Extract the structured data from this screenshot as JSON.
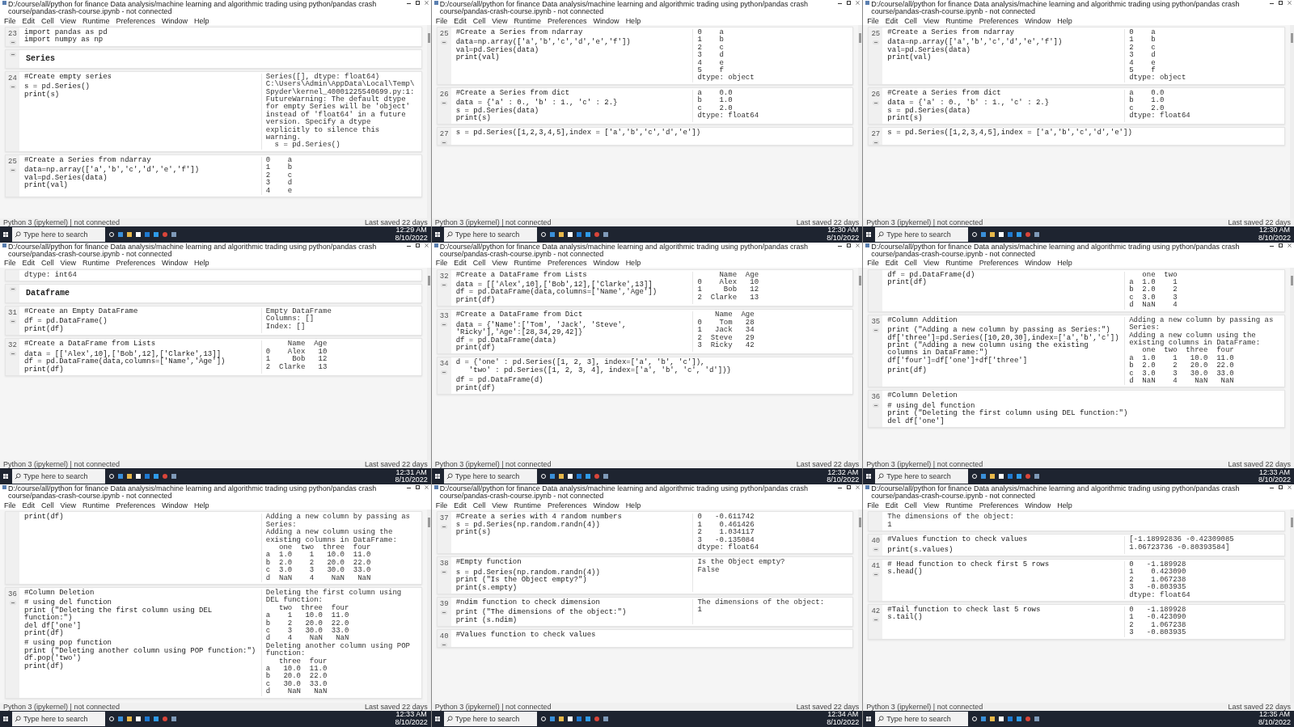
{
  "panels": [
    {
      "title": "D:/course/all/python for finance Data analysis/machine learning and algorithmic trading using python/pandas crash course/pandas-crash-course.ipynb - not connected",
      "menu": [
        "File",
        "Edit",
        "Cell",
        "View",
        "Runtime",
        "Preferences",
        "Window",
        "Help"
      ],
      "cells": [
        {
          "kind": "code",
          "number": "23",
          "code": [
            [
              "import pandas as pd",
              "import numpy as np"
            ]
          ]
        },
        {
          "kind": "markdown",
          "heading": "Series"
        },
        {
          "kind": "code",
          "number": "24",
          "code": [
            [
              "#Create empty series"
            ],
            [
              "s = pd.Series()",
              "print(s)"
            ]
          ],
          "output": [
            "Series([], dtype: float64)",
            "C:\\Users\\Admin\\AppData\\Local\\Temp\\Spyder\\kernel_40001225540699.py:1: FutureWarning: The default dtype for empty Series will be 'object' instead of 'float64' in a future",
            "version. Specify a dtype explicitly to silence this warning.",
            "  s = pd.Series()"
          ]
        },
        {
          "kind": "code",
          "number": "25",
          "code": [
            [
              "#Create a Series from ndarray"
            ],
            [
              "data=np.array(['a','b','c','d','e','f'])",
              "val=pd.Series(data)",
              "print(val)"
            ]
          ],
          "output": [
            "0    a",
            "1    b",
            "2    c",
            "3    d",
            "4    e"
          ]
        }
      ],
      "status": {
        "left": "Python 3 (ipykernel) | not connected",
        "right": "Last saved 22 days"
      },
      "taskbar": {
        "search_placeholder": "Type here to search",
        "time": "12:29 AM",
        "date": "8/10/2022"
      }
    },
    {
      "title": "D:/course/all/python for finance Data analysis/machine learning and algorithmic trading using python/pandas crash course/pandas-crash-course.ipynb - not connected",
      "menu": [
        "File",
        "Edit",
        "Cell",
        "View",
        "Runtime",
        "Preferences",
        "Window",
        "Help"
      ],
      "cells": [
        {
          "kind": "code",
          "number": "25",
          "code": [
            [
              "#Create a Series from ndarray"
            ],
            [
              "data=np.array(['a','b','c','d','e','f'])",
              "val=pd.Series(data)",
              "print(val)"
            ]
          ],
          "output": [
            "0    a",
            "1    b",
            "2    c",
            "3    d",
            "4    e",
            "5    f",
            "dtype: object"
          ]
        },
        {
          "kind": "code",
          "number": "26",
          "code": [
            [
              "#Create a Series from dict"
            ],
            [
              "data = {'a' : 0., 'b' : 1., 'c' : 2.}",
              "s = pd.Series(data)",
              "print(s)"
            ]
          ],
          "output": [
            "a    0.0",
            "b    1.0",
            "c    2.0",
            "dtype: float64"
          ]
        },
        {
          "kind": "code",
          "number": "27",
          "code": [
            [
              "s = pd.Series([1,2,3,4,5],index = ['a','b','c','d','e'])"
            ]
          ]
        }
      ],
      "status": {
        "left": "Python 3 (ipykernel) | not connected",
        "right": "Last saved 22 days"
      },
      "taskbar": {
        "search_placeholder": "Type here to search",
        "time": "12:30 AM",
        "date": "8/10/2022"
      }
    },
    {
      "title": "D:/course/all/python for finance Data analysis/machine learning and algorithmic trading using python/pandas crash course/pandas-crash-course.ipynb - not connected",
      "menu": [
        "File",
        "Edit",
        "Cell",
        "View",
        "Runtime",
        "Preferences",
        "Window",
        "Help"
      ],
      "cells": [
        {
          "kind": "code",
          "number": "25",
          "code": [
            [
              "#Create a Series from ndarray"
            ],
            [
              "data=np.array(['a','b','c','d','e','f'])",
              "val=pd.Series(data)",
              "print(val)"
            ]
          ],
          "output": [
            "0    a",
            "1    b",
            "2    c",
            "3    d",
            "4    e",
            "5    f",
            "dtype: object"
          ]
        },
        {
          "kind": "code",
          "number": "26",
          "code": [
            [
              "#Create a Series from dict"
            ],
            [
              "data = {'a' : 0., 'b' : 1., 'c' : 2.}",
              "s = pd.Series(data)",
              "print(s)"
            ]
          ],
          "output": [
            "a    0.0",
            "b    1.0",
            "c    2.0",
            "dtype: float64"
          ]
        },
        {
          "kind": "code",
          "number": "27",
          "code": [
            [
              "s = pd.Series([1,2,3,4,5],index = ['a','b','c','d','e'])"
            ]
          ]
        }
      ],
      "status": {
        "left": "Python 3 (ipykernel) | not connected",
        "right": "Last saved 22 days"
      },
      "taskbar": {
        "search_placeholder": "Type here to search",
        "time": "12:30 AM",
        "date": "8/10/2022"
      }
    },
    {
      "title": "D:/course/all/python for finance Data analysis/machine learning and algorithmic trading using python/pandas crash course/pandas-crash-course.ipynb - not connected",
      "menu": [
        "File",
        "Edit",
        "Cell",
        "View",
        "Runtime",
        "Preferences",
        "Window",
        "Help"
      ],
      "cells": [
        {
          "kind": "output",
          "output": [
            "dtype: int64"
          ]
        },
        {
          "kind": "markdown",
          "heading": "Dataframe"
        },
        {
          "kind": "code",
          "number": "31",
          "code": [
            [
              "#Create an Empty DataFrame"
            ],
            [
              "df = pd.DataFrame()",
              "print(df)"
            ]
          ],
          "output": [
            "Empty DataFrame",
            "Columns: []",
            "Index: []"
          ]
        },
        {
          "kind": "code",
          "number": "32",
          "code": [
            [
              "#Create a DataFrame from Lists"
            ],
            [
              "data = [['Alex',10],['Bob',12],['Clarke',13]]",
              "df = pd.DataFrame(data,columns=['Name','Age'])",
              "print(df)"
            ]
          ],
          "output": [
            "     Name  Age",
            "0    Alex   10",
            "1     Bob   12",
            "2  Clarke   13"
          ]
        }
      ],
      "status": {
        "left": "Python 3 (ipykernel) | not connected",
        "right": "Last saved 22 days"
      },
      "taskbar": {
        "search_placeholder": "Type here to search",
        "time": "12:31 AM",
        "date": "8/10/2022"
      }
    },
    {
      "title": "D:/course/all/python for finance Data analysis/machine learning and algorithmic trading using python/pandas crash course/pandas-crash-course.ipynb - not connected",
      "menu": [
        "File",
        "Edit",
        "Cell",
        "View",
        "Runtime",
        "Preferences",
        "Window",
        "Help"
      ],
      "cells": [
        {
          "kind": "code",
          "number": "32",
          "code": [
            [
              "#Create a DataFrame from Lists"
            ],
            [
              "data = [['Alex',10],['Bob',12],['Clarke',13]]",
              "df = pd.DataFrame(data,columns=['Name','Age'])",
              "print(df)"
            ]
          ],
          "output": [
            "     Name  Age",
            "0    Alex   10",
            "1     Bob   12",
            "2  Clarke   13"
          ]
        },
        {
          "kind": "code",
          "number": "33",
          "code": [
            [
              "#Create a DataFrame from Dict"
            ],
            [
              "data = {'Name':['Tom', 'Jack', 'Steve', 'Ricky'],'Age':[28,34,29,42]}",
              "df = pd.DataFrame(data)",
              "print(df)"
            ]
          ],
          "output": [
            "    Name  Age",
            "0    Tom   28",
            "1   Jack   34",
            "2  Steve   29",
            "3  Ricky   42"
          ]
        },
        {
          "kind": "code",
          "number": "34",
          "code": [
            [
              "d = {'one' : pd.Series([1, 2, 3], index=['a', 'b', 'c']),",
              "   'two' : pd.Series([1, 2, 3, 4], index=['a', 'b', 'c', 'd'])}"
            ],
            [
              "df = pd.DataFrame(d)",
              "print(df)"
            ]
          ]
        }
      ],
      "status": {
        "left": "Python 3 (ipykernel) | not connected",
        "right": "Last saved 22 days"
      },
      "taskbar": {
        "search_placeholder": "Type here to search",
        "time": "12:32 AM",
        "date": "8/10/2022"
      }
    },
    {
      "title": "D:/course/all/python for finance Data analysis/machine learning and algorithmic trading using python/pandas crash course/pandas-crash-course.ipynb - not connected",
      "menu": [
        "File",
        "Edit",
        "Cell",
        "View",
        "Runtime",
        "Preferences",
        "Window",
        "Help"
      ],
      "cells": [
        {
          "kind": "code",
          "code": [
            [
              "df = pd.DataFrame(d)",
              "print(df)"
            ]
          ],
          "output": [
            "   one  two",
            "a  1.0    1",
            "b  2.0    2",
            "c  3.0    3",
            "d  NaN    4"
          ]
        },
        {
          "kind": "code",
          "number": "35",
          "code": [
            [
              "#Column Addition"
            ],
            [
              "print (\"Adding a new column by passing as Series:\")",
              "df['three']=pd.Series([10,20,30],index=['a','b','c'])",
              "print (\"Adding a new column using the existing columns in DataFrame:\")",
              "df['four']=df['one']+df['three']"
            ],
            [
              "print(df)"
            ]
          ],
          "output": [
            "Adding a new column by passing as Series:",
            "Adding a new column using the existing columns in DataFrame:",
            "   one  two  three  four",
            "a  1.0    1   10.0  11.0",
            "b  2.0    2   20.0  22.0",
            "c  3.0    3   30.0  33.0",
            "d  NaN    4    NaN   NaN"
          ]
        },
        {
          "kind": "code",
          "number": "36",
          "code": [
            [
              "#Column Deletion"
            ],
            [
              "# using del function",
              "print (\"Deleting the first column using DEL function:\")",
              "del df['one']"
            ]
          ]
        }
      ],
      "status": {
        "left": "Python 3 (ipykernel) | not connected",
        "right": "Last saved 22 days"
      },
      "taskbar": {
        "search_placeholder": "Type here to search",
        "time": "12:33 AM",
        "date": "8/10/2022"
      }
    },
    {
      "title": "D:/course/all/python for finance Data analysis/machine learning and algorithmic trading using python/pandas crash course/pandas-crash-course.ipynb - not connected",
      "menu": [
        "File",
        "Edit",
        "Cell",
        "View",
        "Runtime",
        "Preferences",
        "Window",
        "Help"
      ],
      "cells": [
        {
          "kind": "code",
          "code": [
            [
              "print(df)"
            ]
          ],
          "output": [
            "Adding a new column by passing as Series:",
            "Adding a new column using the existing columns in DataFrame:",
            "   one  two  three  four",
            "a  1.0    1   10.0  11.0",
            "b  2.0    2   20.0  22.0",
            "c  3.0    3   30.0  33.0",
            "d  NaN    4    NaN   NaN"
          ]
        },
        {
          "kind": "code",
          "number": "36",
          "code": [
            [
              "#Column Deletion"
            ],
            [
              "# using del function",
              "print (\"Deleting the first column using DEL function:\")",
              "del df['one']",
              "print(df)"
            ],
            [
              "# using pop function",
              "print (\"Deleting another column using POP function:\")",
              "df.pop('two')",
              "print(df)"
            ]
          ],
          "output": [
            "Deleting the first column using DEL function:",
            "   two  three  four",
            "a    1   10.0  11.0",
            "b    2   20.0  22.0",
            "c    3   30.0  33.0",
            "d    4    NaN   NaN",
            "Deleting another column using POP function:",
            "   three  four",
            "a   10.0  11.0",
            "b   20.0  22.0",
            "c   30.0  33.0",
            "d    NaN   NaN"
          ]
        }
      ],
      "status": {
        "left": "Python 3 (ipykernel) | not connected",
        "right": "Last saved 22 days"
      },
      "taskbar": {
        "search_placeholder": "Type here to search",
        "time": "12:33 AM",
        "date": "8/10/2022"
      }
    },
    {
      "title": "D:/course/all/python for finance Data analysis/machine learning and algorithmic trading using python/pandas crash course/pandas-crash-course.ipynb - not connected",
      "menu": [
        "File",
        "Edit",
        "Cell",
        "View",
        "Runtime",
        "Preferences",
        "Window",
        "Help"
      ],
      "cells": [
        {
          "kind": "code",
          "number": "37",
          "code": [
            [
              "#Create a series with 4 random numbers",
              "s = pd.Series(np.random.randn(4))",
              "print(s)"
            ]
          ],
          "output": [
            "0   -0.611742",
            "1    0.461426",
            "2    1.034117",
            "3   -0.135084",
            "dtype: float64"
          ]
        },
        {
          "kind": "code",
          "number": "38",
          "code": [
            [
              "#Empty function"
            ],
            [
              "s = pd.Series(np.random.randn(4))",
              "print (\"Is the Object empty?\")",
              "print(s.empty)"
            ]
          ],
          "output": [
            "Is the Object empty?",
            "False"
          ]
        },
        {
          "kind": "code",
          "number": "39",
          "code": [
            [
              "#ndim function to check dimension"
            ],
            [
              "print (\"The dimensions of the object:\")",
              "print (s.ndim)"
            ]
          ],
          "output": [
            "The dimensions of the object:",
            "1"
          ]
        },
        {
          "kind": "code",
          "number": "40",
          "code": [
            [
              "#Values function to check values"
            ]
          ]
        }
      ],
      "status": {
        "left": "Python 3 (ipykernel) | not connected",
        "right": "Last saved 22 days"
      },
      "taskbar": {
        "search_placeholder": "Type here to search",
        "time": "12:34 AM",
        "date": "8/10/2022"
      }
    },
    {
      "title": "D:/course/all/python for finance Data analysis/machine learning and algorithmic trading using python/pandas crash course/pandas-crash-course.ipynb - not connected",
      "menu": [
        "File",
        "Edit",
        "Cell",
        "View",
        "Runtime",
        "Preferences",
        "Window",
        "Help"
      ],
      "cells": [
        {
          "kind": "output",
          "output": [
            "The dimensions of the object:",
            "1"
          ]
        },
        {
          "kind": "code",
          "number": "40",
          "code": [
            [
              "#Values function to check values"
            ],
            [
              "print(s.values)"
            ]
          ],
          "output": [
            "[-1.18992836 -0.42309085  1.06723736 -0.80393584]"
          ]
        },
        {
          "kind": "code",
          "number": "41",
          "code": [
            [
              "# Head function to check first 5 rows",
              "s.head()"
            ]
          ],
          "output": [
            "0   -1.189928",
            "1    0.423090",
            "2    1.067238",
            "3   -0.803935",
            "dtype: float64"
          ]
        },
        {
          "kind": "code",
          "number": "42",
          "code": [
            [
              "#Tail function to check last 5 rows",
              "s.tail()"
            ]
          ],
          "output": [
            "0   -1.189928",
            "1   -0.423090",
            "2    1.067238",
            "3   -0.803935"
          ]
        }
      ],
      "status": {
        "left": "Python 3 (ipykernel) | not connected",
        "right": "Last saved 22 days"
      },
      "taskbar": {
        "search_placeholder": "Type here to search",
        "time": "12:35 AM",
        "date": "8/10/2022"
      }
    }
  ]
}
